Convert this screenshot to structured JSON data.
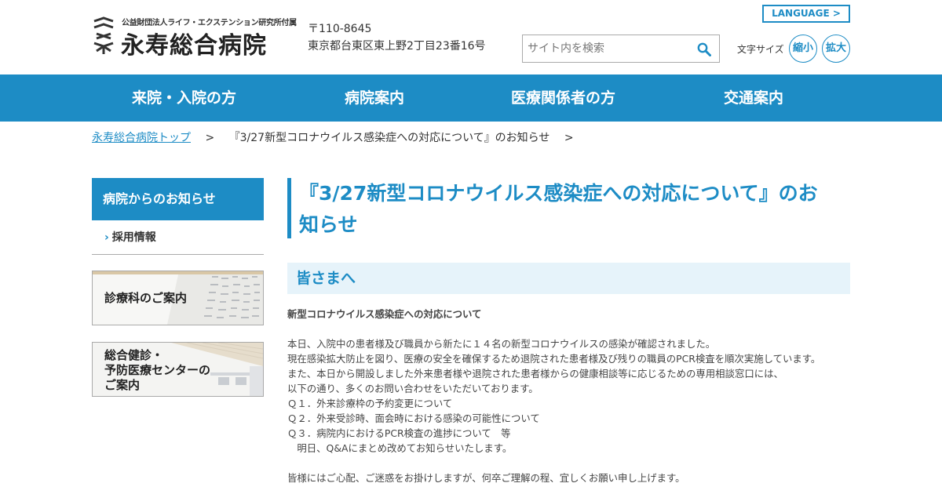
{
  "header": {
    "logo_sub": "公益財団法人ライフ・エクステンション研究所付属",
    "logo_main": "永寿総合病院",
    "postal": "〒110-8645",
    "address": "東京都台東区東上野2丁目23番16号",
    "language_label": "LANGUAGE >",
    "search_placeholder": "サイト内を検索",
    "font_size_label": "文字サイズ",
    "shrink_label": "縮小",
    "enlarge_label": "拡大"
  },
  "nav": {
    "items": [
      {
        "label": "来院・入院の方"
      },
      {
        "label": "病院案内"
      },
      {
        "label": "医療関係者の方"
      },
      {
        "label": "交通案内"
      }
    ]
  },
  "breadcrumb": {
    "home": "永寿総合病院トップ",
    "sep": ">",
    "current": "『3/27新型コロナウイルス感染症への対応について』のお知らせ"
  },
  "sidebar": {
    "heading": "病院からのお知らせ",
    "sub_item": "採用情報",
    "chevron": "›",
    "banner1": "診療科のご案内",
    "banner2_lines": [
      "総合健診・",
      "予防医療センターの",
      "ご案内"
    ]
  },
  "main": {
    "title_line1": "『3/27新型コロナウイルス感染症への対応について』のお",
    "title_line2": "知らせ",
    "subheading": "皆さまへ",
    "lead": "新型コロナウイルス感染症への対応について",
    "paragraphs": [
      "本日、入院中の患者様及び職員から新たに１４名の新型コロナウイルスの感染が確認されました。",
      "現在感染拡大防止を図り、医療の安全を確保するため退院された患者様及び残りの職員のPCR検査を順次実施しています。",
      "また、本日から開設しました外来患者様や退院された患者様からの健康相談等に応じるための専用相談窓口には、",
      "以下の通り、多くのお問い合わせをいただいております。",
      "Ｑ１．外来診療枠の予約変更について",
      "Ｑ２．外来受診時、面会時における感染の可能性について",
      "Ｑ３．病院内におけるPCR検査の進捗について　等",
      "　明日、Q&Aにまとめ改めてお知らせいたします。"
    ],
    "closing": "皆様にはご心配、ご迷惑をお掛けしますが、何卒ご理解の程、宜しくお願い申し上げます。"
  },
  "colors": {
    "brand_blue": "#1d8cc5",
    "subhead_bg": "#e6f3fa"
  },
  "icons": {
    "search": "magnifier-icon",
    "logo": "logo-mark-icon"
  }
}
